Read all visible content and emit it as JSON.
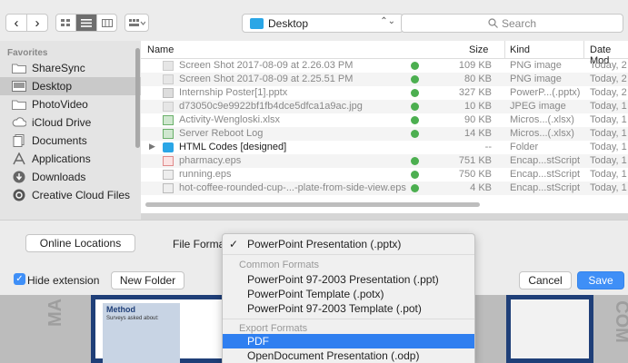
{
  "toolbar": {
    "back_glyph": "‹",
    "forward_glyph": "›",
    "location": "Desktop",
    "search_placeholder": "Search"
  },
  "sidebar": {
    "heading": "Favorites",
    "items": [
      {
        "label": "ShareSync",
        "icon": "folder-icon"
      },
      {
        "label": "Desktop",
        "icon": "desktop-icon",
        "selected": true
      },
      {
        "label": "PhotoVideo",
        "icon": "folder-icon"
      },
      {
        "label": "iCloud Drive",
        "icon": "cloud-icon"
      },
      {
        "label": "Documents",
        "icon": "documents-icon"
      },
      {
        "label": "Applications",
        "icon": "applications-icon"
      },
      {
        "label": "Downloads",
        "icon": "downloads-icon"
      },
      {
        "label": "Creative Cloud Files",
        "icon": "creative-cloud-icon"
      }
    ]
  },
  "files": {
    "columns": {
      "name": "Name",
      "size": "Size",
      "kind": "Kind",
      "date": "Date Mod"
    },
    "rows": [
      {
        "name": "Screen Shot 2017-08-09 at 2.26.03 PM",
        "size": "109 KB",
        "kind": "PNG image",
        "date": "Today, 2",
        "synced": true
      },
      {
        "name": "Screen Shot 2017-08-09 at 2.25.51 PM",
        "size": "80 KB",
        "kind": "PNG image",
        "date": "Today, 2",
        "synced": true
      },
      {
        "name": "Internship Poster[1].pptx",
        "size": "327 KB",
        "kind": "PowerP...(.pptx)",
        "date": "Today, 2",
        "synced": true
      },
      {
        "name": "d73050c9e9922bf1fb4dce5dfca1a9ac.jpg",
        "size": "10 KB",
        "kind": "JPEG image",
        "date": "Today, 1",
        "synced": true
      },
      {
        "name": "Activity-Wengloski.xlsx",
        "size": "90 KB",
        "kind": "Micros...(.xlsx)",
        "date": "Today, 1",
        "synced": true
      },
      {
        "name": "Server Reboot Log",
        "size": "14 KB",
        "kind": "Micros...(.xlsx)",
        "date": "Today, 1",
        "synced": true
      },
      {
        "name": "HTML Codes [designed]",
        "size": "--",
        "kind": "Folder",
        "date": "Today, 1",
        "synced": false,
        "folder": true
      },
      {
        "name": "pharmacy.eps",
        "size": "751 KB",
        "kind": "Encap...stScript",
        "date": "Today, 1",
        "synced": true
      },
      {
        "name": "running.eps",
        "size": "750 KB",
        "kind": "Encap...stScript",
        "date": "Today, 1",
        "synced": true
      },
      {
        "name": "hot-coffee-rounded-cup-...-plate-from-side-view.eps",
        "size": "4 KB",
        "kind": "Encap...stScript",
        "date": "Today, 1",
        "synced": true
      }
    ]
  },
  "bottom": {
    "online_locations": "Online Locations",
    "file_format_label": "File Format",
    "hide_extension": "Hide extension",
    "new_folder": "New Folder",
    "cancel": "Cancel",
    "save": "Save"
  },
  "format_menu": {
    "current": "PowerPoint Presentation (.pptx)",
    "common_heading": "Common Formats",
    "common": [
      "PowerPoint 97-2003 Presentation (.ppt)",
      "PowerPoint Template (.potx)",
      "PowerPoint 97-2003 Template (.pot)"
    ],
    "export_heading": "Export Formats",
    "export": [
      "PDF",
      "OpenDocument Presentation (.odp)"
    ],
    "highlighted": "PDF"
  },
  "background": {
    "poster_heading": "Method",
    "poster_text": "Surveys asked about:",
    "watermark_left": "MA",
    "watermark_right": "COM"
  },
  "colors": {
    "accent": "#3f8ff7",
    "folder": "#2aa6e6",
    "sync_ok": "#4caf50",
    "poster_border": "#1f3f78"
  }
}
